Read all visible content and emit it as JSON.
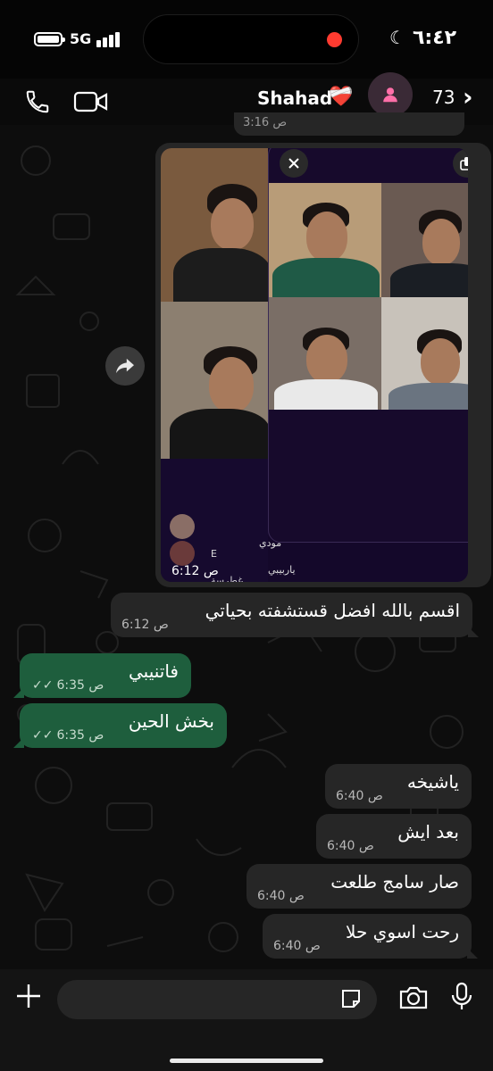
{
  "status_bar": {
    "network": "5G",
    "time": "٦:٤٢"
  },
  "header": {
    "contact_name": "Shahad",
    "heart_emoji": "❤️‍🩹",
    "unread_count": "73"
  },
  "peek_message": {
    "time": "3:16 ص"
  },
  "image_message": {
    "time": "6:12 ص",
    "overlay_comments": [
      "مودي",
      "E",
      "ياربيبي",
      "غطرسة"
    ]
  },
  "messages": [
    {
      "direction": "incoming",
      "text": "اقسم بالله افضل قستشفته بحياتي",
      "time": "6:12 ص"
    },
    {
      "direction": "outgoing",
      "text": "فاتنيبي",
      "time": "6:35 ص"
    },
    {
      "direction": "outgoing",
      "text": "بخش الحين",
      "time": "6:35 ص"
    },
    {
      "direction": "incoming",
      "text": "ياشيخه",
      "time": "6:40 ص"
    },
    {
      "direction": "incoming",
      "text": "بعد ايش",
      "time": "6:40 ص"
    },
    {
      "direction": "incoming",
      "text": "صار سامج طلعت",
      "time": "6:40 ص"
    },
    {
      "direction": "incoming",
      "text": "رحت اسوي حلا",
      "time": "6:40 ص"
    }
  ],
  "input": {
    "placeholder": ""
  },
  "colors": {
    "outgoing_bubble": "#1e5e3d",
    "incoming_bubble": "#262626",
    "background": "#0d0d0d",
    "record_dot": "#ff3b30"
  },
  "icons": [
    "phone-icon",
    "video-call-icon",
    "avatar-icon",
    "forward-icon",
    "close-icon",
    "pip-expand-icon",
    "plus-icon",
    "sticker-icon",
    "camera-icon",
    "mic-icon"
  ]
}
